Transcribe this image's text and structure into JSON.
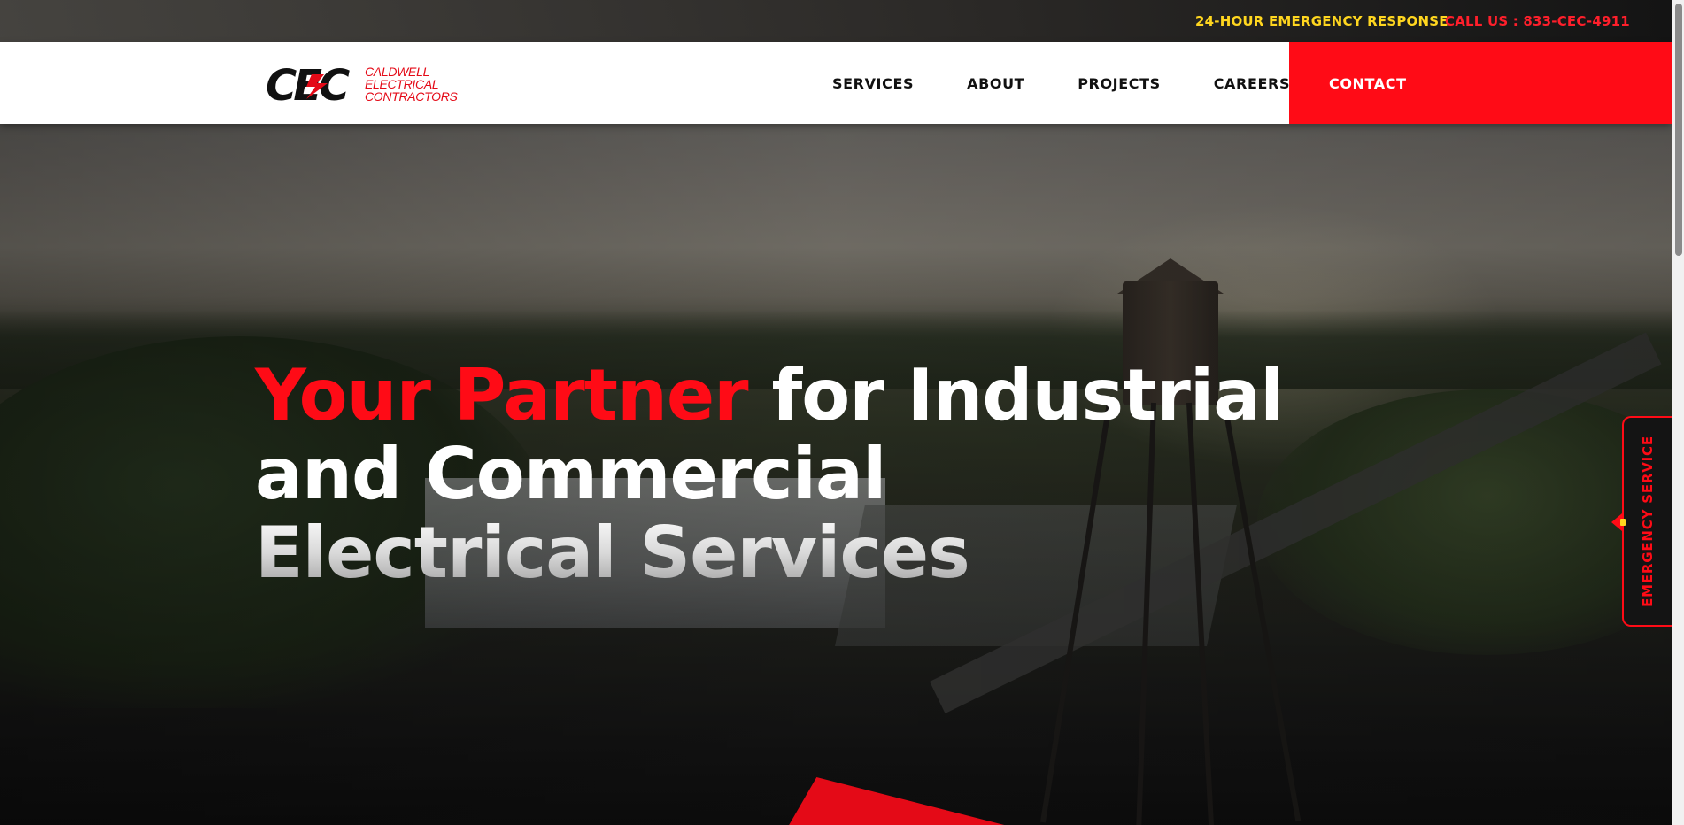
{
  "topbar": {
    "emergency_text": "24-HOUR EMERGENCY RESPONSE",
    "call_text": "CALL US : 833-CEC-4911"
  },
  "header": {
    "logo": {
      "mark": "CEC",
      "words": [
        "CALDWELL",
        "ELECTRICAL",
        "CONTRACTORS"
      ]
    },
    "nav": {
      "items": [
        {
          "label": "SERVICES"
        },
        {
          "label": "ABOUT"
        },
        {
          "label": "PROJECTS"
        },
        {
          "label": "CAREERS"
        }
      ],
      "contact_label": "CONTACT"
    }
  },
  "hero": {
    "headline_red": "Your Partner",
    "headline_line1_rest": " for Industrial",
    "headline_line2": "and Commercial",
    "headline_line3": "Electrical Services"
  },
  "side_tab": {
    "label": "EMERGENCY SERVICE"
  },
  "colors": {
    "brand_red": "#ff0b16",
    "accent_yellow": "#ffd61f",
    "nav_text": "#111111"
  },
  "icons": [
    "lightning-bolt-icon",
    "scrollbar"
  ]
}
